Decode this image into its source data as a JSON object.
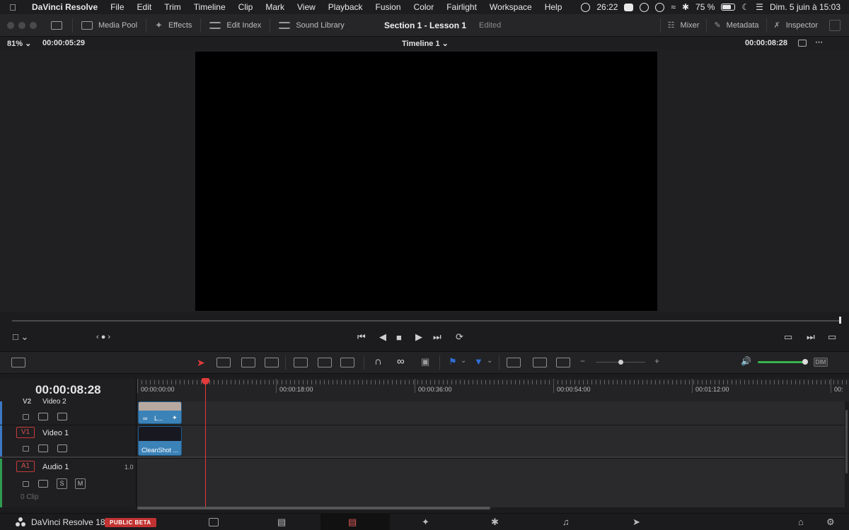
{
  "menubar": {
    "app_name": "DaVinci Resolve",
    "items": [
      "File",
      "Edit",
      "Trim",
      "Timeline",
      "Clip",
      "Mark",
      "View",
      "Playback",
      "Fusion",
      "Color",
      "Fairlight",
      "Workspace",
      "Help"
    ],
    "timer": "26:22",
    "battery": "75 %",
    "datetime": "Dim. 5 juin à  15:03"
  },
  "toolbar": {
    "media_pool": "Media Pool",
    "effects": "Effects",
    "edit_index": "Edit Index",
    "sound_library": "Sound Library",
    "project_title": "Section 1 - Lesson 1",
    "project_status": "Edited",
    "mixer": "Mixer",
    "metadata": "Metadata",
    "inspector": "Inspector"
  },
  "viewer": {
    "zoom": "81%",
    "source_timecode": "00:00:05:29",
    "timeline_name": "Timeline 1",
    "record_timecode": "00:00:08:28"
  },
  "timeline": {
    "current_timecode": "00:00:08:28",
    "playhead_position_seconds": 8.93,
    "ruler_labels": [
      "00:00:00:00",
      "00:00:18:00",
      "00:00:36:00",
      "00:00:54:00",
      "00:01:12:00",
      "00:"
    ],
    "tracks": {
      "v2": {
        "badge": "V2",
        "name": "Video 2"
      },
      "v1": {
        "badge": "V1",
        "name": "Video 1"
      },
      "a1": {
        "badge": "A1",
        "name": "Audio 1",
        "level": "1.0",
        "clip_count": "0 Clip",
        "solo": "S",
        "mute": "M"
      }
    },
    "clips": {
      "v2_clip": "L...",
      "v1_clip": "CleanShot ..."
    }
  },
  "pagebar": {
    "app_name": "DaVinci Resolve 18",
    "badge": "PUBLIC BETA",
    "active_page": "Edit"
  },
  "colors": {
    "playhead": "#e23b3b",
    "clip_blue": "#3b82b7",
    "video_track_accent": "#3d79c3",
    "audio_track_accent": "#2f9a52",
    "volume_green": "#36b34a",
    "beta_red": "#c23232"
  }
}
